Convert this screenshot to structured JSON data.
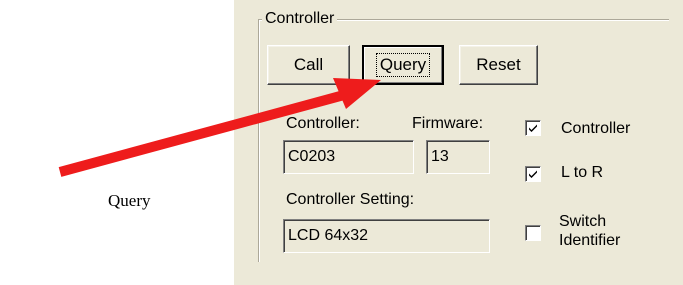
{
  "annotation": {
    "label": "Query",
    "arrow_color": "#ee1c1c"
  },
  "controller_group": {
    "title": "Controller",
    "buttons": {
      "call": "Call",
      "query": "Query",
      "reset": "Reset"
    },
    "fields": {
      "controller_label": "Controller:",
      "controller_value": "C0203",
      "firmware_label": "Firmware:",
      "firmware_value": "13",
      "setting_label": "Controller Setting:",
      "setting_value": "LCD 64x32"
    },
    "checkboxes": [
      {
        "label": "Controller",
        "checked": true
      },
      {
        "label": "L to R",
        "checked": true
      },
      {
        "label": "Switch\nIdentifier",
        "checked": false
      }
    ]
  }
}
